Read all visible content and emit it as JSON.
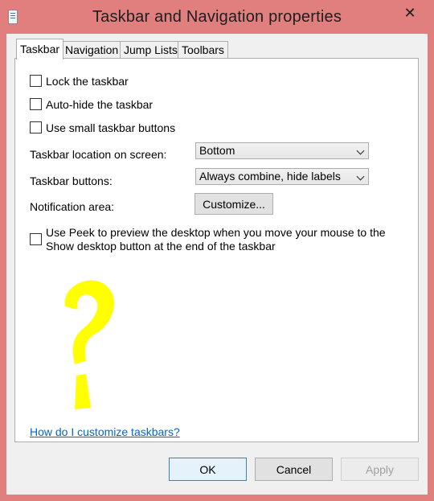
{
  "window": {
    "title": "Taskbar and Navigation properties",
    "close_glyph": "✕"
  },
  "tabs": [
    {
      "label": "Taskbar",
      "active": true
    },
    {
      "label": "Navigation",
      "active": false
    },
    {
      "label": "Jump Lists",
      "active": false
    },
    {
      "label": "Toolbars",
      "active": false
    }
  ],
  "options": {
    "lock_taskbar": {
      "label": "Lock the taskbar",
      "checked": false
    },
    "auto_hide": {
      "label": "Auto-hide the taskbar",
      "checked": false
    },
    "small_buttons": {
      "label": "Use small taskbar buttons",
      "checked": false
    }
  },
  "location": {
    "label": "Taskbar location on screen:",
    "value": "Bottom"
  },
  "buttons_setting": {
    "label": "Taskbar buttons:",
    "value": "Always combine, hide labels"
  },
  "notification": {
    "label": "Notification area:",
    "button": "Customize..."
  },
  "peek": {
    "line1": "Use Peek to preview the desktop when you move your mouse to the",
    "line2": "Show desktop button at the end of the taskbar",
    "checked": false
  },
  "overlay": {
    "glyph": "question-mark",
    "color": "#ffff00"
  },
  "help_link": "How do I customize taskbars?",
  "footer": {
    "ok": "OK",
    "cancel": "Cancel",
    "apply": "Apply"
  }
}
